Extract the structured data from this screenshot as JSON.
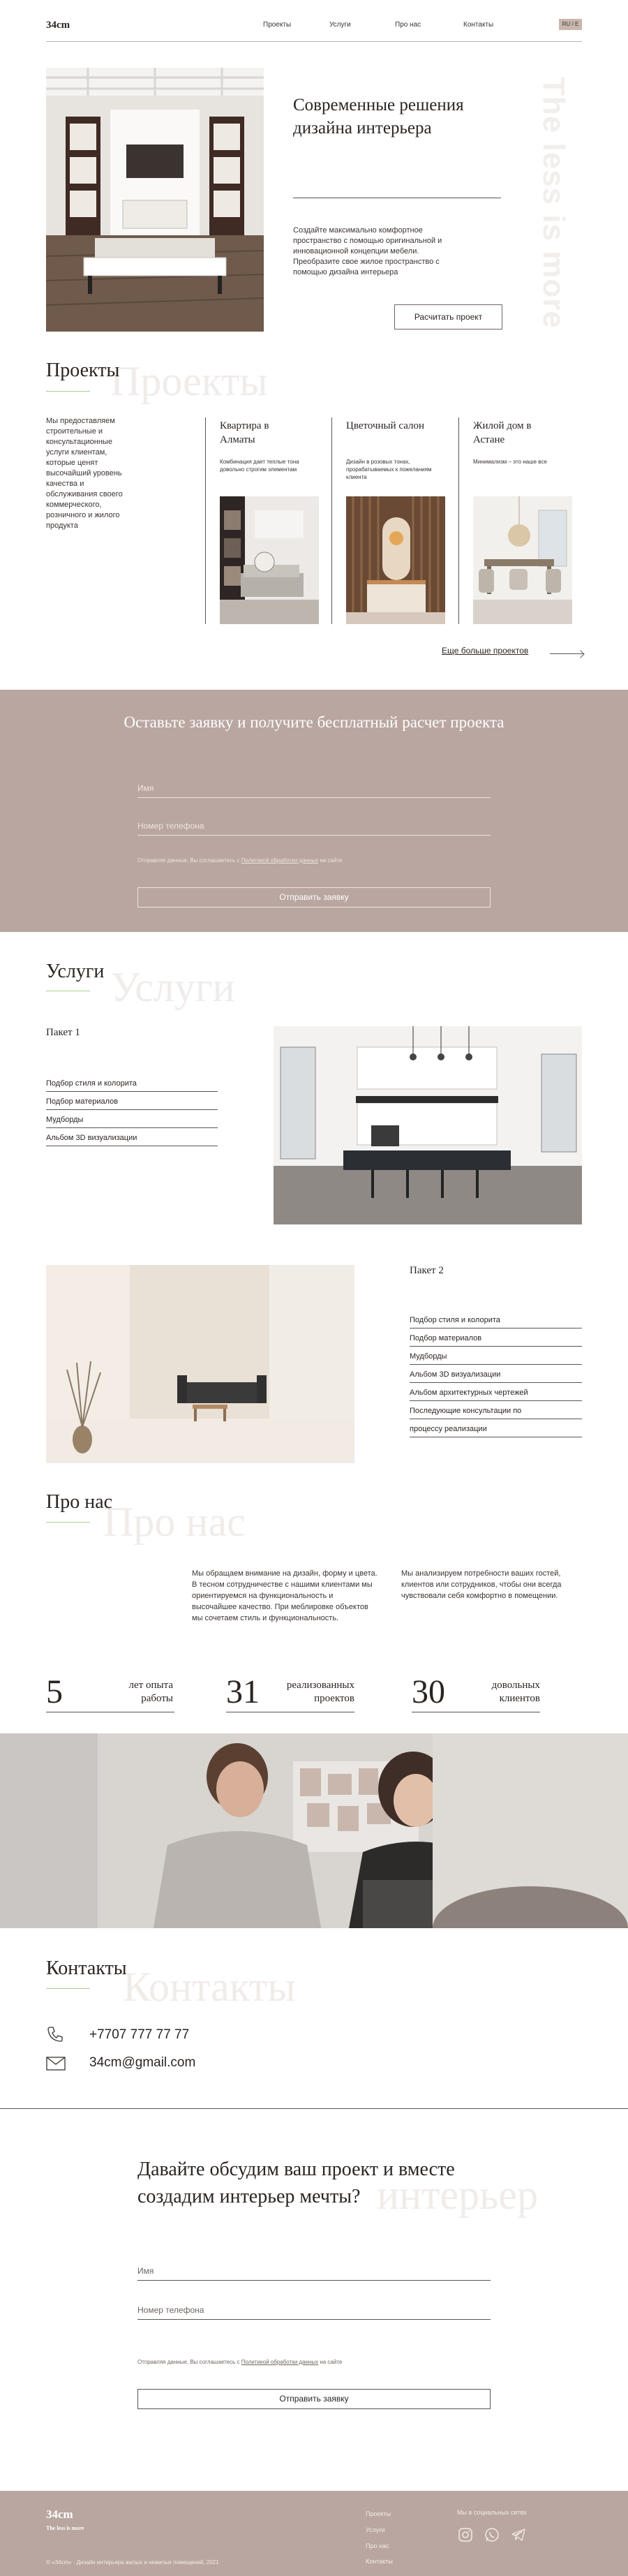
{
  "header": {
    "logo": "34cm",
    "nav": [
      "Проекты",
      "Услуги",
      "Про нас",
      "Контакты"
    ],
    "lang": "RU / E"
  },
  "hero": {
    "title": "Современные решения дизайна интерьера",
    "text": "Создайте максимально комфортное пространство с помощью оригинальной и инновационной концепции мебели. Преобразите свое жилое пространство с помощью дизайна интерьера",
    "button": "Расчитать проект",
    "vertical_text": "The less is more"
  },
  "projects": {
    "title": "Проекты",
    "ghost": "Проекты",
    "intro": "Мы предоставляем строительные и консультационные услуги клиентам, которые ценят высочайший уровень качества и обслуживания своего коммерческого, розничного и жилого продукта",
    "items": [
      {
        "name": "Квартира в Алматы",
        "desc": "Комбинация дает теплые тона довольно строгим элементам"
      },
      {
        "name": "Цветочный салон",
        "desc": "Дизайн в розовых тонах, прорабатываемых к пожеланиям клиента"
      },
      {
        "name": "Жилой дом в Астане",
        "desc": "Минимализм – это наше все"
      }
    ],
    "more": "Еще больше проектов"
  },
  "request": {
    "title": "Оставьте заявку и получите бесплатный расчет проекта",
    "name_placeholder": "Имя",
    "phone_placeholder": "Номер телефона",
    "consent_prefix": "Отправляя данные, Вы соглашаетесь с ",
    "consent_link": "Политикой обработки данных",
    "consent_suffix": " на сайте",
    "button": "Отправить заявку"
  },
  "services": {
    "title": "Услуги",
    "ghost": "Услуги",
    "pack1": {
      "title": "Пакет 1",
      "items": [
        "Подбор стиля и колорита",
        "Подбор материалов",
        "Мудборды",
        "Альбом 3D визуализации"
      ]
    },
    "pack2": {
      "title": "Пакет 2",
      "items": [
        "Подбор стиля и колорита",
        "Подбор материалов",
        "Мудборды",
        "Альбом 3D визуализации",
        "Альбом архитектурных чертежей",
        "Последующие консультации по",
        "процессу реализации"
      ]
    }
  },
  "about": {
    "title": "Про нас",
    "ghost": "Про нас",
    "text1": "Мы обращаем внимание на дизайн, форму и цвета. В тесном сотрудничестве с нашими клиентами мы ориентируемся на функциональность и высочайшее качество. При меблировке объектов мы сочетаем стиль и функциональность.",
    "text2": "Мы анализируем потребности ваших гостей, клиентов или сотрудников, чтобы они всегда чувствовали себя комфортно в помещении.",
    "stats": [
      {
        "num": "5",
        "label1": "лет опыта",
        "label2": "работы"
      },
      {
        "num": "31",
        "label1": "реализованных",
        "label2": "проектов"
      },
      {
        "num": "30",
        "label1": "довольных",
        "label2": "клиентов"
      }
    ]
  },
  "contacts": {
    "title": "Контакты",
    "ghost": "Контакты",
    "phone": "+7707 777 77 77",
    "email": "34cm@gmail.com"
  },
  "discuss": {
    "title": "Давайте обсудим ваш проект и вместе создадим интерьер мечты?",
    "ghost": "интерьер",
    "name_placeholder": "Имя",
    "phone_placeholder": "Номер телефона",
    "consent_prefix": "Отправляя данные, Вы соглашаетесь с ",
    "consent_link": "Политикой обработки данных",
    "consent_suffix": " на сайте",
    "button": "Отправить заявку"
  },
  "footer": {
    "logo": "34cm",
    "sub": "The less is more",
    "copyright": "© «34cm» - Дизайн интерьера жилых и нежилых помещений, 2021",
    "nav": [
      "Проекты",
      "Услуги",
      "Про нас",
      "Контакты"
    ],
    "social_title": "Мы в социальных сетях"
  },
  "colors": {
    "accent": "#b9a6a0",
    "text": "#2b2522",
    "underline": "#a8cf95"
  }
}
